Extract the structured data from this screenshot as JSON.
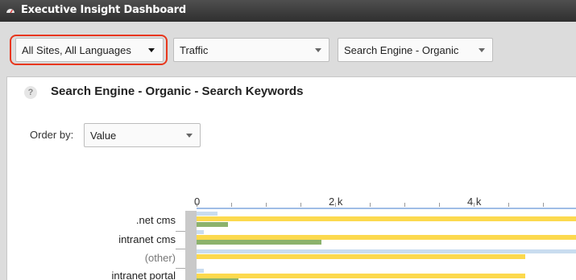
{
  "window": {
    "title": "Executive Insight Dashboard",
    "icon": "gauge-icon"
  },
  "toolbar": {
    "site_select": {
      "value": "All Sites, All Languages"
    },
    "metric_select": {
      "value": "Traffic"
    },
    "source_select": {
      "value": "Search Engine - Organic"
    }
  },
  "report": {
    "help_icon_label": "?",
    "title": "Search Engine - Organic - Search Keywords",
    "order_by_label": "Order by:",
    "order_by_value": "Value"
  },
  "colors": {
    "highlight": "#e8361b",
    "series_light_blue": "#c9dcef",
    "series_yellow": "#fcd94e",
    "series_green": "#8cb26c",
    "axis": "#9fbde6"
  },
  "chart_data": {
    "type": "bar",
    "orientation": "horizontal",
    "x_ticks": [
      "0",
      "2 k",
      "4 k"
    ],
    "xlim": [
      0,
      5500
    ],
    "categories": [
      ".net cms",
      "intranet cms",
      "(other)",
      "intranet portal"
    ],
    "series": [
      {
        "color": "#c9dcef",
        "values": [
          300,
          100,
          5500,
          100
        ]
      },
      {
        "color": "#fcd94e",
        "values": [
          5500,
          5500,
          4750,
          4750
        ]
      },
      {
        "color": "#8cb26c",
        "values": [
          450,
          1800,
          null,
          600
        ]
      }
    ]
  }
}
